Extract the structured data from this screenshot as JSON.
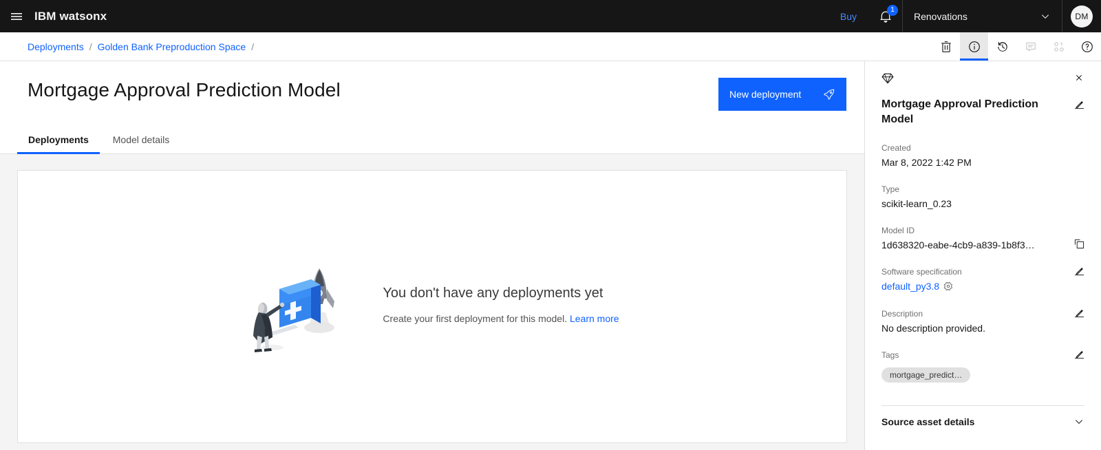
{
  "header": {
    "menu_icon": "hamburger-menu-icon",
    "brand_prefix": "IBM",
    "brand_product": "watsonx",
    "buy_label": "Buy",
    "notification_icon": "bell-icon",
    "notification_count": "1",
    "account_name": "Renovations",
    "account_chevron": "chevron-down-icon",
    "avatar_initials": "DM"
  },
  "breadcrumb": {
    "items": [
      {
        "label": "Deployments"
      },
      {
        "label": "Golden Bank Preproduction Space"
      }
    ],
    "separator": "/",
    "trailing_separator": "/"
  },
  "toolbar": {
    "actions": [
      {
        "name": "trash-icon",
        "label": "Delete",
        "state": "enabled"
      },
      {
        "name": "information-icon",
        "label": "Information",
        "state": "active"
      },
      {
        "name": "history-icon",
        "label": "History",
        "state": "enabled"
      },
      {
        "name": "comment-icon",
        "label": "Comments",
        "state": "disabled"
      },
      {
        "name": "data-class-icon",
        "label": "Data",
        "state": "disabled"
      },
      {
        "name": "help-icon",
        "label": "Help",
        "state": "enabled"
      }
    ]
  },
  "main": {
    "page_title": "Mortgage Approval Prediction Model",
    "new_deployment_label": "New deployment",
    "new_deployment_icon": "rocket-icon",
    "tabs": [
      {
        "label": "Deployments",
        "selected": true
      },
      {
        "label": "Model details",
        "selected": false
      }
    ],
    "empty_state": {
      "illustration": "deployment-empty-illustration",
      "heading": "You don't have any deployments yet",
      "subtext": "Create your first deployment for this model.",
      "link_label": "Learn more"
    }
  },
  "panel": {
    "asset_icon": "model-gem-icon",
    "close_icon": "close-icon",
    "title": "Mortgage Approval Prediction Model",
    "edit_icon": "edit-pencil-icon",
    "fields": [
      {
        "label": "Created",
        "value": "Mar 8, 2022 1:42 PM"
      },
      {
        "label": "Type",
        "value": "scikit-learn_0.23"
      },
      {
        "label": "Model ID",
        "value": "1d638320-eabe-4cb9-a839-1b8f3…",
        "action_icon": "copy-icon"
      },
      {
        "label": "Software specification",
        "value": "default_py3.8",
        "value_is_link": true,
        "inline_icon": "gear-icon",
        "action_icon": "edit-pencil-icon"
      },
      {
        "label": "Description",
        "value": "No description provided.",
        "action_icon": "edit-pencil-icon"
      }
    ],
    "tags": {
      "label": "Tags",
      "action_icon": "edit-pencil-icon",
      "items": [
        "mortgage_predict…"
      ]
    },
    "accordion": {
      "label": "Source asset details",
      "chevron_icon": "chevron-down-icon"
    }
  },
  "colors": {
    "brand_blue": "#0f62fe",
    "link_blue": "#0f62fe",
    "header_black": "#161616",
    "page_gray": "#f4f4f4",
    "border_gray": "#e0e0e0"
  }
}
